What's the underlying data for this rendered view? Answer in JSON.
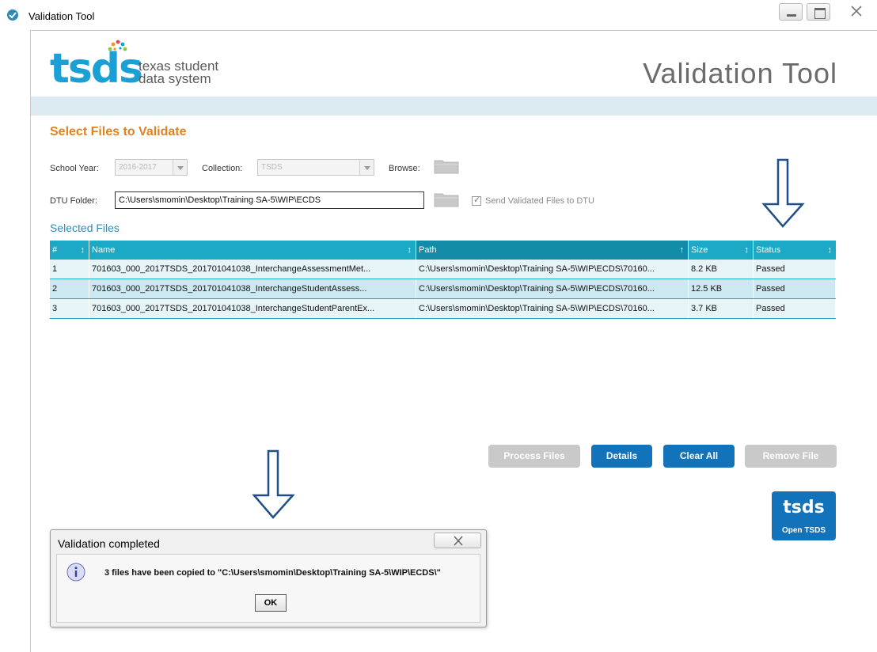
{
  "window": {
    "title": "Validation Tool"
  },
  "header": {
    "logo_mark": "tsds",
    "logo_sub_line1": "texas student",
    "logo_sub_line2": "data system",
    "app_title": "Validation Tool"
  },
  "select_files": {
    "title": "Select Files to Validate",
    "school_year_label": "School Year:",
    "school_year_value": "2016-2017",
    "collection_label": "Collection:",
    "collection_value": "TSDS",
    "browse_label": "Browse:",
    "dtu_folder_label": "DTU Folder:",
    "dtu_folder_value": "C:\\Users\\smomin\\Desktop\\Training SA-5\\WIP\\ECDS",
    "send_checkbox_label": "Send Validated Files to DTU"
  },
  "selected_files": {
    "title": "Selected Files",
    "columns": [
      "#",
      "Name",
      "Path",
      "Size",
      "Status"
    ],
    "rows": [
      {
        "num": "1",
        "name": "701603_000_2017TSDS_201701041038_InterchangeAssessmentMet...",
        "path": "C:\\Users\\smomin\\Desktop\\Training SA-5\\WIP\\ECDS\\70160...",
        "size": "8.2 KB",
        "status": "Passed"
      },
      {
        "num": "2",
        "name": "701603_000_2017TSDS_201701041038_InterchangeStudentAssess...",
        "path": "C:\\Users\\smomin\\Desktop\\Training SA-5\\WIP\\ECDS\\70160...",
        "size": "12.5 KB",
        "status": "Passed"
      },
      {
        "num": "3",
        "name": "701603_000_2017TSDS_201701041038_InterchangeStudentParentEx...",
        "path": "C:\\Users\\smomin\\Desktop\\Training SA-5\\WIP\\ECDS\\70160...",
        "size": "3.7 KB",
        "status": "Passed"
      }
    ]
  },
  "actions": {
    "process_files": "Process Files",
    "details": "Details",
    "clear_all": "Clear All",
    "remove_file": "Remove File",
    "open_tsds_mark": "tsds",
    "open_tsds_label": "Open TSDS"
  },
  "dialog": {
    "title": "Validation completed",
    "message": "3 files have been copied to \"C:\\Users\\smomin\\Desktop\\Training SA-5\\WIP\\ECDS\\\"",
    "ok": "OK"
  },
  "colors": {
    "accent_teal": "#1ba9c6",
    "primary_blue": "#1373ba",
    "section_orange": "#e0821e"
  }
}
